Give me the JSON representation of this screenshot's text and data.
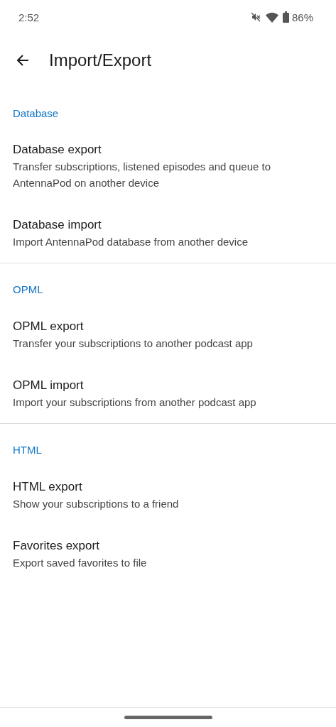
{
  "status_bar": {
    "time": "2:52",
    "battery": "86%"
  },
  "app_bar": {
    "title": "Import/Export"
  },
  "sections": [
    {
      "header": "Database",
      "items": [
        {
          "title": "Database export",
          "summary": "Transfer subscriptions, listened episodes and queue to AntennaPod on another device"
        },
        {
          "title": "Database import",
          "summary": "Import AntennaPod database from another device"
        }
      ]
    },
    {
      "header": "OPML",
      "items": [
        {
          "title": "OPML export",
          "summary": "Transfer your subscriptions to another podcast app"
        },
        {
          "title": "OPML import",
          "summary": "Import your subscriptions from another podcast app"
        }
      ]
    },
    {
      "header": "HTML",
      "items": [
        {
          "title": "HTML export",
          "summary": "Show your subscriptions to a friend"
        },
        {
          "title": "Favorites export",
          "summary": "Export saved favorites to file"
        }
      ]
    }
  ]
}
